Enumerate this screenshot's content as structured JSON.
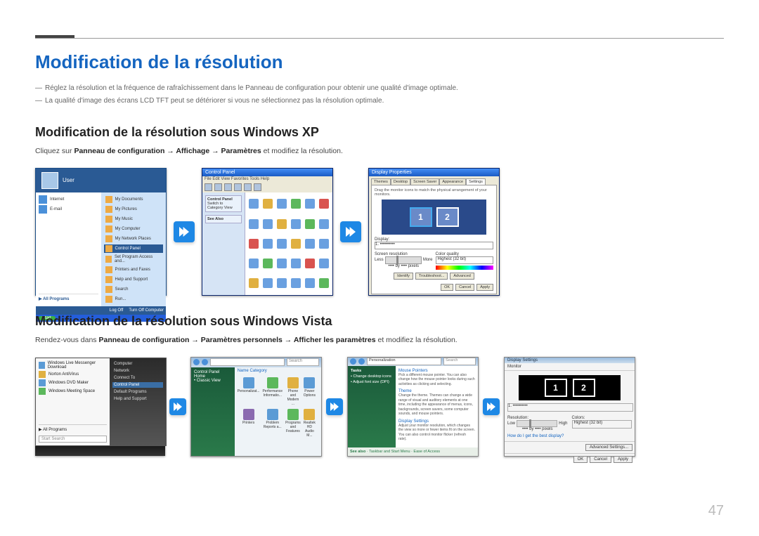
{
  "page_number": "47",
  "title": "Modification de la résolution",
  "notes": [
    "Réglez la résolution et la fréquence de rafraîchissement dans le Panneau de configuration pour obtenir une qualité d'image optimale.",
    "La qualité d'image des écrans LCD TFT peut se détériorer si vous ne sélectionnez pas la résolution optimale."
  ],
  "xp": {
    "heading": "Modification de la résolution sous Windows XP",
    "instr_pre": "Cliquez sur ",
    "instr_path": "Panneau de configuration → Affichage → Paramètres",
    "instr_post": " et modifiez la résolution.",
    "start": {
      "user": "User",
      "left": [
        "Internet",
        "E-mail"
      ],
      "right": [
        "My Documents",
        "My Pictures",
        "My Music",
        "My Computer",
        "My Network Places",
        "Control Panel",
        "Set Program Access and...",
        "Printers and Faxes",
        "Help and Support",
        "Search",
        "Run..."
      ],
      "all_programs": "All Programs",
      "logoff": "Log Off",
      "shutdown": "Turn Off Computer",
      "start_label": "start"
    },
    "cp": {
      "title": "Control Panel",
      "menu": "File  Edit  View  Favorites  Tools  Help",
      "side_title": "Control Panel",
      "side_link": "Switch to Category View",
      "seealso": "See Also"
    },
    "disp": {
      "title": "Display Properties",
      "tabs": [
        "Themes",
        "Desktop",
        "Screen Saver",
        "Appearance",
        "Settings"
      ],
      "hint": "Drag the monitor icons to match the physical arrangement of your monitors.",
      "display_label": "Display:",
      "display_value": "1. ••••••••••",
      "res_label": "Screen resolution",
      "res_less": "Less",
      "res_more": "More",
      "res_value": "•••• by •••• pixels",
      "color_label": "Color quality",
      "color_value": "Highest (32 bit)",
      "identify": "Identify",
      "troubleshoot": "Troubleshoot...",
      "advanced": "Advanced",
      "ok": "OK",
      "cancel": "Cancel",
      "apply": "Apply"
    }
  },
  "vista": {
    "heading": "Modification de la résolution sous Windows Vista",
    "instr_pre": "Rendez-vous dans ",
    "instr_path": "Panneau de configuration → Paramètres personnels → Afficher les paramètres",
    "instr_post": " et modifiez la résolution.",
    "start": {
      "left": [
        "Windows Live Messenger Download",
        "Norton AntiVirus",
        "Windows DVD Maker",
        "Windows Meeting Space"
      ],
      "all_programs": "All Programs",
      "search": "Start Search",
      "right": [
        "Computer",
        "Network",
        "Connect To",
        "Control Panel",
        "Default Programs",
        "Help and Support"
      ]
    },
    "cp": {
      "search": "Search",
      "side1": "Control Panel Home",
      "side2": "Classic View",
      "name_row": "Name      Category",
      "items": [
        "Personalizat...",
        "Performance Informatio...",
        "Phone and Modem ...",
        "Power Options",
        "Printers",
        "Problem Reports a...",
        "Programs and Features",
        "Realtek HD Audio M..."
      ]
    },
    "pers": {
      "title": "Personalization",
      "search": "Search",
      "tasks": "Tasks",
      "task1": "Change desktop icons",
      "task2": "Adjust font size (DPI)",
      "seealso": "See also",
      "seealso1": "Taskbar and Start Menu",
      "seealso2": "Ease of Access",
      "mouse_hd": "Mouse Pointers",
      "mouse_tx": "Pick a different mouse pointer. You can also change how the mouse pointer looks during such activities as clicking and selecting.",
      "theme_hd": "Theme",
      "theme_tx": "Change the theme. Themes can change a wide range of visual and auditory elements at one time, including the appearance of menus, icons, backgrounds, screen savers, some computer sounds, and mouse pointers.",
      "ds_hd": "Display Settings",
      "ds_tx": "Adjust your monitor resolution, which changes the view so more or fewer items fit on the screen. You can also control monitor flicker (refresh rate)."
    },
    "ds": {
      "title": "Display Settings",
      "tab": "Monitor",
      "sel": "1. ••••••••••",
      "res_label": "Resolution:",
      "low": "Low",
      "high": "High",
      "res_value": "•••• by •••• pixels",
      "color_label": "Colors:",
      "color_value": "Highest (32 bit)",
      "link": "How do I get the best display?",
      "adv": "Advanced Settings...",
      "ok": "OK",
      "cancel": "Cancel",
      "apply": "Apply"
    }
  }
}
